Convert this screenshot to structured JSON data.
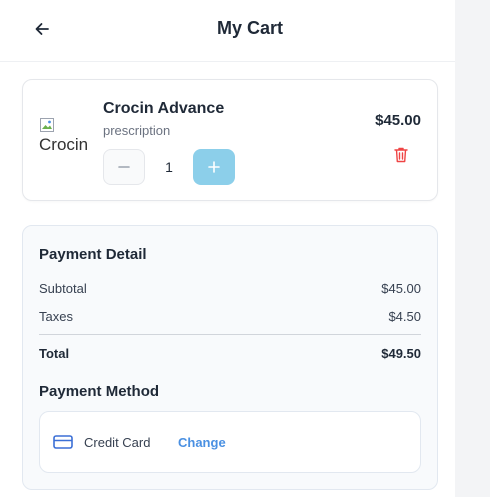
{
  "header": {
    "title": "My Cart",
    "back_icon": "arrow-left-icon"
  },
  "cart": {
    "items": [
      {
        "name": "Crocin Advance",
        "subtitle": "prescription",
        "image_alt": "Crocin",
        "quantity": "1",
        "price": "$45.00"
      }
    ]
  },
  "payment": {
    "title": "Payment Detail",
    "subtotal_label": "Subtotal",
    "subtotal_value": "$45.00",
    "taxes_label": "Taxes",
    "taxes_value": "$4.50",
    "total_label": "Total",
    "total_value": "$49.50"
  },
  "method": {
    "title": "Payment Method",
    "label": "Credit Card",
    "change_label": "Change",
    "icon": "credit-card-icon"
  },
  "colors": {
    "accent_blue": "#4a90e2",
    "plus_button": "#8ccfea",
    "delete_red": "#ef4444",
    "card_icon": "#3b6fd6"
  }
}
